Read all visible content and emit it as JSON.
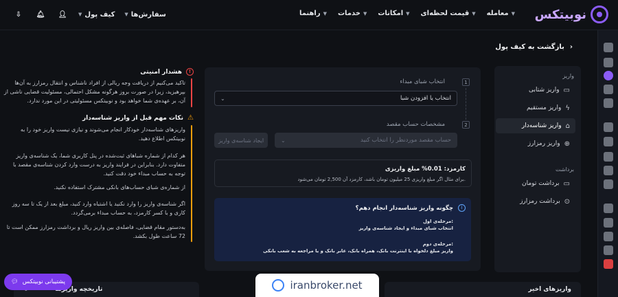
{
  "brand": {
    "name": "نوبیتکس"
  },
  "nav": [
    {
      "label": "معامله"
    },
    {
      "label": "قیمت لحظه‌ای"
    },
    {
      "label": "امکانات"
    },
    {
      "label": "خدمات"
    },
    {
      "label": "راهنما"
    }
  ],
  "top_left": {
    "orders_label": "سفارش‌ها",
    "wallet_label": "کیف پول"
  },
  "back": {
    "label": "بازگشت به کیف پول"
  },
  "menu": {
    "deposit_section": "واریز",
    "withdraw_section": "برداشت",
    "items": [
      {
        "label": "واریز شتابی"
      },
      {
        "label": "واریز مستقیم"
      },
      {
        "label": "واریز شناسه‌دار"
      },
      {
        "label": "واریز رمزارز"
      },
      {
        "label": "برداشت تومان"
      },
      {
        "label": "برداشت رمزارز"
      }
    ]
  },
  "form": {
    "step1_label": "انتخاب شبای مبداء",
    "step1_num": "1",
    "step1_select": "انتخاب یا افزودن شبا",
    "step2_label": "مشخصات حساب مقصد",
    "step2_num": "2",
    "step2_select": "حساب مقصد موردنظر را انتخاب کنید",
    "create_button": "ایجاد شناسه‌ی واریز"
  },
  "fee": {
    "title": "کارمزد: 0.01% مبلغ واریزی",
    "desc": "برای مثال اگر مبلغ واریزی 25 میلیون تومان باشد، کارمزد آن 2,500 تومان می‌شود."
  },
  "how": {
    "title": "چگونه واریز شناسه‌دار انجام دهم؟",
    "step1_title": "مرحله‌ی اول:",
    "step1_text": "انتخاب شبای مبداء و ایجاد شناسه‌ی واریز",
    "step2_title": "مرحله‌ی دوم:",
    "step2_text": "واریز مبلغ دلخواه با اینترنت بانک، همراه بانک، عابر بانک و یا مراجعه به شعب بانکی"
  },
  "security": {
    "title": "هشدار امنیتی",
    "text": "تاکید می‌کنیم از دریافت وجه ریالی از افراد ناشناس و انتقال رمزارز به آن‌ها بپرهیزید، زیرا در صورت بروز هرگونه مشکل احتمالی، مسئولیت قضایی ناشی از آن، بر عهده‌ی شما خواهد بود و نوبیتکس مسئولیتی در این مورد ندارد."
  },
  "tips": {
    "title": "نکات مهم قبل از واریز شناسه‌دار",
    "p1": "واریزهای شناسه‌دار خودکار انجام می‌شوند و نیازی نیست واریز خود را به نوبیتکس اطلاع دهید.",
    "p2": "هر کدام از شماره شباهای ثبت‌شده در پنل کاربری شما، یک شناسه‌ی واریز متفاوت دارد. بنابراین در فرایند واریز به درست وارد کردن شناسه‌ی مقصد با توجه به حساب مبداء خود دقت کنید.",
    "p3": "از شماره‌ی شبای حساب‌های بانکی مشترک استفاده نکنید.",
    "p4": "اگر شناسه‌ی واریز را وارد نکنید یا اشتباه وارد کنید، مبلغ بعد از یک تا سه روز کاری و با کسر کارمزد، به حساب مبداء برمی‌گردد.",
    "p5": "به‌دستور مقام قضایی، فاصله‌ی بین واریز ریال و برداشت رمزارز ممکن است تا 72 ساعت طول بکشد."
  },
  "support": {
    "label": "پشتیبانی نوبیتکس"
  },
  "watermark": {
    "text": "iranbroker.net"
  },
  "bottom": {
    "left_label": "تاریخچه واریزها",
    "right_label": "واریزهای اخیر"
  }
}
